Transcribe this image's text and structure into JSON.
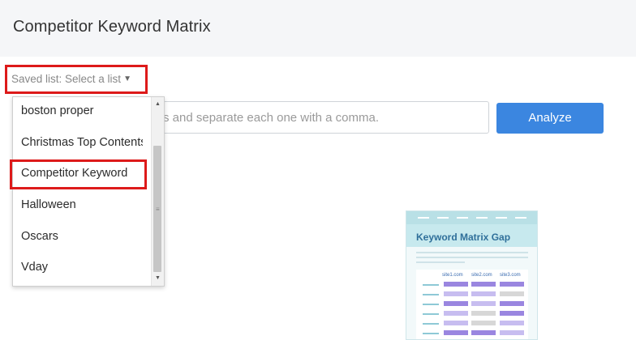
{
  "header": {
    "title": "Competitor Keyword Matrix"
  },
  "saved_list": {
    "label": "Saved list: Select a list"
  },
  "keywords_input": {
    "value": "s and separate each one with a comma."
  },
  "analyze_button": {
    "label": "Analyze"
  },
  "dropdown": {
    "items": [
      {
        "label": "boston proper"
      },
      {
        "label": "Christmas Top Contents"
      },
      {
        "label": "Competitor Keyword"
      },
      {
        "label": "Halloween"
      },
      {
        "label": "Oscars"
      },
      {
        "label": "Vday"
      }
    ],
    "highlighted_item": "Competitor Keyword"
  },
  "illustration": {
    "title": "Keyword Matrix Gap",
    "columns": [
      "site1.com",
      "site2.com",
      "site3.com"
    ]
  },
  "colors": {
    "highlight_border": "#dd1a1a",
    "analyze_button": "#3b86e0",
    "illustration_accent": "#b9e0e6"
  }
}
